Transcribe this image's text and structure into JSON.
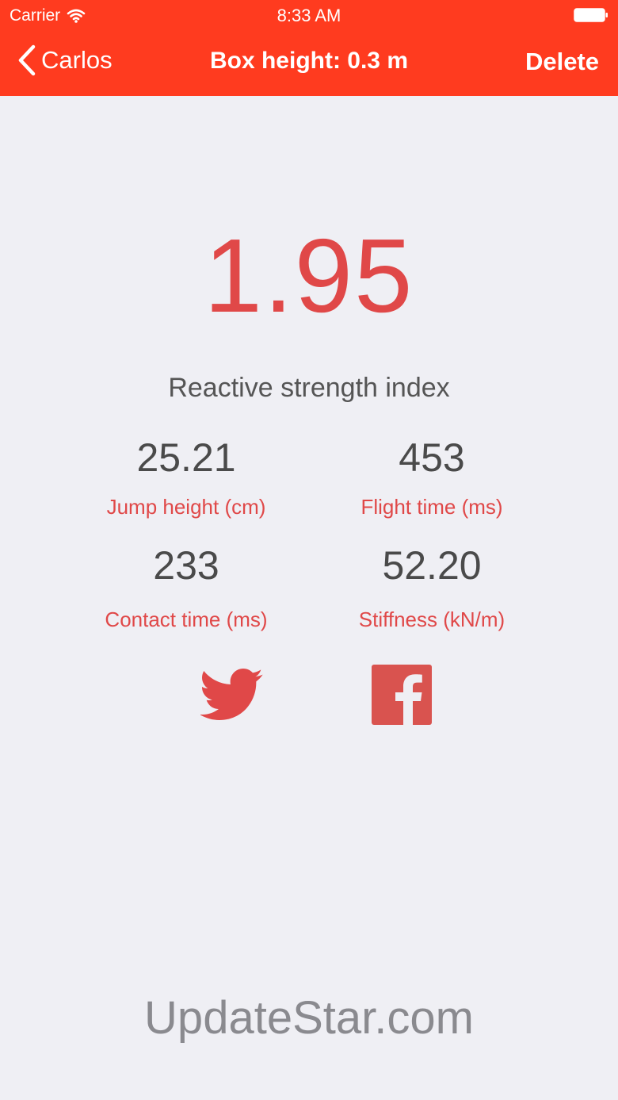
{
  "status_bar": {
    "carrier": "Carrier",
    "time": "8:33 AM"
  },
  "nav": {
    "back_label": "Carlos",
    "title": "Box height: 0.3 m",
    "delete_label": "Delete"
  },
  "result": {
    "rsi_value": "1.95",
    "rsi_label": "Reactive strength index"
  },
  "metrics": [
    {
      "value": "25.21",
      "label": "Jump height (cm)"
    },
    {
      "value": "453",
      "label": "Flight time (ms)"
    },
    {
      "value": "233",
      "label": "Contact time (ms)"
    },
    {
      "value": "52.20",
      "label": "Stiffness (kN/m)"
    }
  ],
  "share": {
    "icons": [
      "twitter-icon",
      "facebook-icon"
    ]
  },
  "watermark": "UpdateStar.com",
  "colors": {
    "nav_bar": "#ff3b1f",
    "accent": "#e04848",
    "background": "#efeff4"
  }
}
